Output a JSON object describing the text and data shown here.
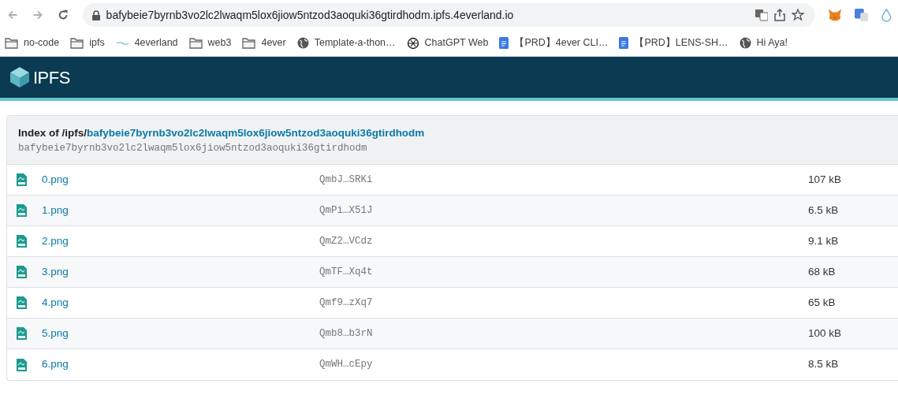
{
  "browser": {
    "url": "bafybeie7byrnb3vo2lc2lwaqm5lox6jiow5ntzod3aoquki36gtirdhodm.ipfs.4everland.io",
    "bookmarks": [
      {
        "label": "no-code",
        "kind": "folder"
      },
      {
        "label": "ipfs",
        "kind": "folder"
      },
      {
        "label": "4everland",
        "kind": "wave"
      },
      {
        "label": "web3",
        "kind": "folder"
      },
      {
        "label": "4ever",
        "kind": "folder"
      },
      {
        "label": "Template-a-thon…",
        "kind": "globe"
      },
      {
        "label": "ChatGPT Web",
        "kind": "knot"
      },
      {
        "label": "【PRD】4ever CLI…",
        "kind": "doc"
      },
      {
        "label": "【PRD】LENS-SH…",
        "kind": "doc"
      },
      {
        "label": "Hi Aya!",
        "kind": "globe"
      }
    ]
  },
  "site": {
    "logo": "IPFS"
  },
  "listing": {
    "title_prefix": "Index of /ipfs/",
    "cid_link": "bafybeie7byrnb3vo2lc2lwaqm5lox6jiow5ntzod3aoquki36gtirdhodm",
    "cid": "bafybeie7byrnb3vo2lc2lwaqm5lox6jiow5ntzod3aoquki36gtirdhodm",
    "files": [
      {
        "name": "0.png",
        "hash": "QmbJ…SRKi",
        "size": "107 kB"
      },
      {
        "name": "1.png",
        "hash": "QmPi…X51J",
        "size": "6.5 kB"
      },
      {
        "name": "2.png",
        "hash": "QmZ2…VCdz",
        "size": "9.1 kB"
      },
      {
        "name": "3.png",
        "hash": "QmTF…Xq4t",
        "size": "68 kB"
      },
      {
        "name": "4.png",
        "hash": "Qmf9…zXq7",
        "size": "65 kB"
      },
      {
        "name": "5.png",
        "hash": "Qmb8…b3rN",
        "size": "100 kB"
      },
      {
        "name": "6.png",
        "hash": "QmWH…cEpy",
        "size": "8.5 kB"
      }
    ]
  }
}
